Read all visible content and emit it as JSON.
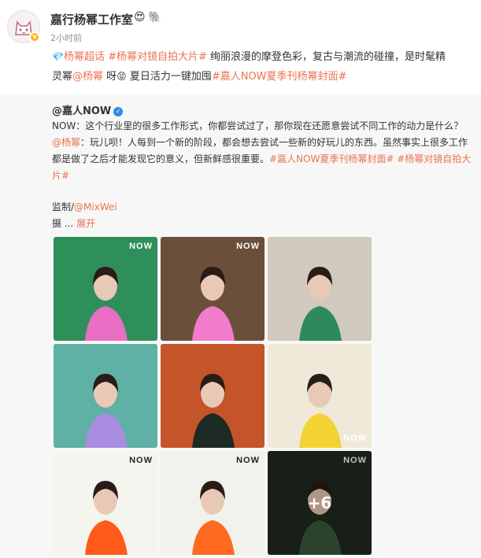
{
  "post": {
    "author": "嘉行杨幂工作室",
    "author_emojis": [
      "😍",
      "🐘"
    ],
    "timestamp": "2小时前",
    "line1": [
      {
        "t": "💎",
        "c": "icon"
      },
      {
        "t": "杨幂超话",
        "c": "link"
      },
      {
        "t": " ",
        "c": ""
      },
      {
        "t": "#杨幂对镜自拍大片#",
        "c": "link"
      },
      {
        "t": " 绚丽浪漫的摩登色彩，复古与潮流的碰撞，是时髦精",
        "c": ""
      }
    ],
    "line2": [
      {
        "t": "灵幂",
        "c": ""
      },
      {
        "t": "@杨幂",
        "c": "link"
      },
      {
        "t": " 呀",
        "c": ""
      },
      {
        "t": "😝",
        "c": "icon"
      },
      {
        "t": " 夏日活力一键加囤",
        "c": ""
      },
      {
        "t": "#嘉人NOW夏季刊杨幂封面#",
        "c": "link"
      }
    ]
  },
  "repost": {
    "author": "@嘉人NOW",
    "verified_mark": "✓",
    "line1": [
      {
        "t": "NOW：这个行业里的很多工作形式，你都尝试过了，那你现在还愿意尝试不同工作的动力是什么？",
        "c": ""
      }
    ],
    "line2": [
      {
        "t": "@杨幂",
        "c": "link"
      },
      {
        "t": "：玩儿呗！人每到一个新的阶段，都会想去尝试一些新的好玩儿的东西。虽然事实上很多工作",
        "c": ""
      }
    ],
    "line3": [
      {
        "t": "都是做了之后才能发现它的意义，但新鲜感很重要。",
        "c": ""
      },
      {
        "t": "#嘉人NOW夏季刊杨幂封面#",
        "c": "link"
      },
      {
        "t": " ",
        "c": ""
      },
      {
        "t": "#杨幂对镜自拍大片#",
        "c": "link"
      }
    ],
    "credit_label": "监制/",
    "credit_link": "@MixWei",
    "photographer_label": "摄",
    "expand_ellipsis": "...",
    "expand_label": "展开"
  },
  "gallery": {
    "logo_text": "NOW",
    "more_count": "+6",
    "images": [
      {
        "name": "photo-1-pink-sweater-portrait",
        "bg": "#2f8f5a",
        "accent": "#e86fc4"
      },
      {
        "name": "photo-2-pink-dress-ladder",
        "bg": "#6b4f3a",
        "accent": "#f27ccb"
      },
      {
        "name": "photo-3-collage",
        "bg": "#cfc9be",
        "accent": "#2e8a5a"
      },
      {
        "name": "photo-4-purple-hat",
        "bg": "#5fb0a5",
        "accent": "#a98de0"
      },
      {
        "name": "photo-5-orange-fabric-bag",
        "bg": "#c6542a",
        "accent": "#1e2a24"
      },
      {
        "name": "photo-6-yellow-dress",
        "bg": "#f0e9d9",
        "accent": "#f3d233"
      },
      {
        "name": "photo-7-orange-outfit-bag",
        "bg": "#f4f5ef",
        "accent": "#ff5a1a"
      },
      {
        "name": "photo-8-orange-suit-green",
        "bg": "#f2f2ec",
        "accent": "#ff6a20"
      },
      {
        "name": "photo-9-closeup-portrait",
        "bg": "#1f2a1f",
        "accent": "#3b5a3a"
      }
    ]
  }
}
